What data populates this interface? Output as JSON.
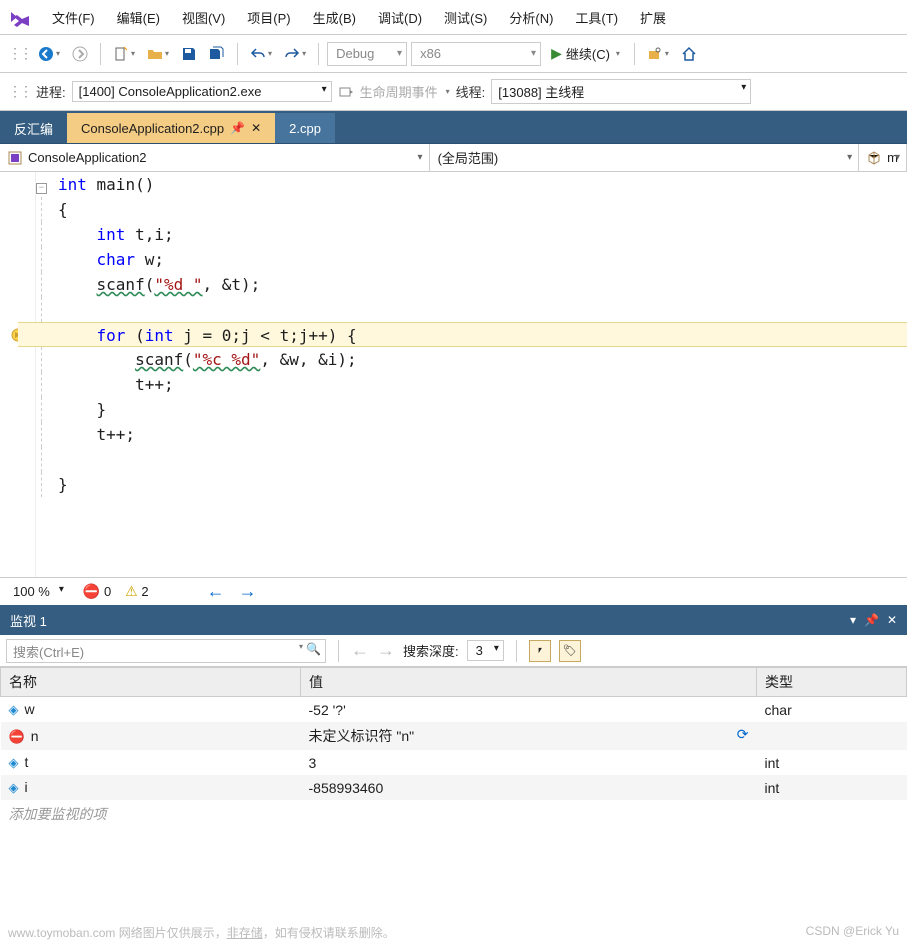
{
  "menu": [
    "文件(F)",
    "编辑(E)",
    "视图(V)",
    "项目(P)",
    "生成(B)",
    "调试(D)",
    "测试(S)",
    "分析(N)",
    "工具(T)",
    "扩展"
  ],
  "toolbar": {
    "config": "Debug",
    "platform": "x86",
    "continue_label": "继续(C)"
  },
  "toolbar2": {
    "process_label": "进程:",
    "process_value": "[1400] ConsoleApplication2.exe",
    "lifecycle_label": "生命周期事件",
    "thread_label": "线程:",
    "thread_value": "[13088] 主线程"
  },
  "tabs": {
    "disasm": "反汇编",
    "active": "ConsoleApplication2.cpp",
    "other": "2.cpp"
  },
  "nav": {
    "project": "ConsoleApplication2",
    "scope": "(全局范围)",
    "member": "m"
  },
  "code_lines": [
    {
      "fold": "⊟",
      "html": "<span class='kw'>int</span> main()"
    },
    {
      "html": "{"
    },
    {
      "html": "    <span class='kw'>int</span> t,i;"
    },
    {
      "html": "    <span class='kw'>char</span> w;"
    },
    {
      "html": "    <span class='squiggle'>scanf</span>(<span class='str squiggle'>\"%d \"</span>, &amp;t);"
    },
    {
      "html": ""
    },
    {
      "bp": true,
      "fold": "⊟",
      "hl": true,
      "html": "    <span class='kw'>for</span> (<span class='kw'>int</span> j = 0;j &lt; t;j++) {"
    },
    {
      "html": "        <span class='squiggle'>scanf</span>(<span class='str squiggle'>\"%c %d\"</span>, &amp;w, &amp;i);"
    },
    {
      "html": "        t++;"
    },
    {
      "html": "    }"
    },
    {
      "html": "    t++;"
    },
    {
      "html": ""
    },
    {
      "html": "}"
    }
  ],
  "status": {
    "zoom": "100 %",
    "errors": "0",
    "warnings": "2"
  },
  "watch": {
    "title": "监视 1",
    "search_ph": "搜索(Ctrl+E)",
    "depth_label": "搜索深度:",
    "depth_value": "3",
    "cols": {
      "name": "名称",
      "value": "值",
      "type": "类型"
    },
    "rows": [
      {
        "icon": "var",
        "name": "w",
        "value": "-52 '?'",
        "type": "char"
      },
      {
        "icon": "err",
        "name": "n",
        "value": "未定义标识符 \"n\"",
        "type": "",
        "refresh": true
      },
      {
        "icon": "var",
        "name": "t",
        "value": "3",
        "type": "int"
      },
      {
        "icon": "var",
        "name": "i",
        "value": "-858993460",
        "type": "int"
      }
    ],
    "add_label": "添加要监视的项"
  },
  "footer": {
    "left": "www.toymoban.com 网络图片仅供展示，",
    "linked": "非存储",
    "left2": "，如有侵权请联系删除。",
    "right": "CSDN @Erick Yu"
  }
}
